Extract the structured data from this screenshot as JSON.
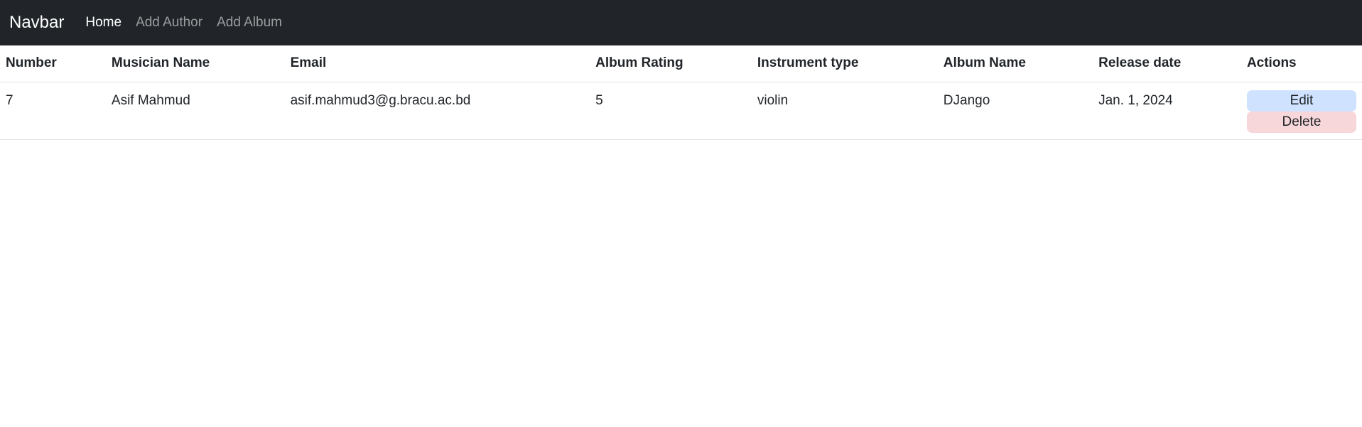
{
  "navbar": {
    "brand": "Navbar",
    "links": [
      {
        "label": "Home",
        "active": true
      },
      {
        "label": "Add Author",
        "active": false
      },
      {
        "label": "Add Album",
        "active": false
      }
    ],
    "background_color": "#212529"
  },
  "table": {
    "headers": [
      "Number",
      "Musician Name",
      "Email",
      "Album Rating",
      "Instrument type",
      "Album Name",
      "Release date",
      "Actions"
    ],
    "rows": [
      {
        "number": "7",
        "musician_name": "Asif Mahmud",
        "email": "asif.mahmud3@g.bracu.ac.bd",
        "album_rating": "5",
        "instrument_type": "violin",
        "album_name": "DJango",
        "release_date": "Jan. 1, 2024",
        "actions": {
          "edit_label": "Edit",
          "delete_label": "Delete"
        }
      }
    ]
  },
  "colors": {
    "edit_button": "#cfe2ff",
    "delete_button": "#f8d7da"
  }
}
